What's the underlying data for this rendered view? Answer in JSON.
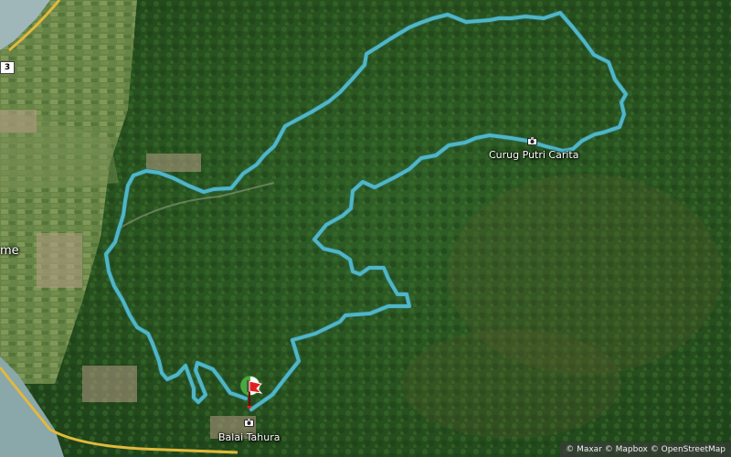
{
  "map": {
    "labels": {
      "curug": "Curug Putri Carita",
      "balai": "Balai Tahura",
      "town_fragment": "me",
      "road_number": "3"
    },
    "attribution": "© Maxar © Mapbox © OpenStreetMap",
    "route_color": "#4fb6c6",
    "icons": [
      "camera-icon",
      "start-flag-icon",
      "finish-marker-icon"
    ]
  }
}
